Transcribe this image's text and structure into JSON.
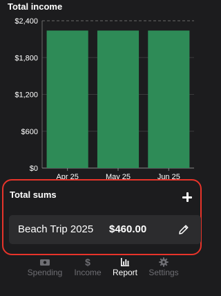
{
  "colors": {
    "background": "#1c1c1e",
    "bar": "#2e8b57",
    "highlight_border": "#e8342a",
    "row_background": "#2c2c2e",
    "tab_inactive": "#6e6e73",
    "tab_active": "#ffffff"
  },
  "chart_data": {
    "type": "bar",
    "title": "Total income",
    "categories": [
      "Apr 25",
      "May 25",
      "Jun 25"
    ],
    "values": [
      2240,
      2240,
      2240
    ],
    "ylim": [
      0,
      2400
    ],
    "yticks": [
      0,
      600,
      1200,
      1800,
      2400
    ],
    "ytick_labels": [
      "$0",
      "$600",
      "$1,200",
      "$1,800",
      "$2,400"
    ],
    "grid": true,
    "top_line_dashed": true,
    "legend": "none"
  },
  "total_sums": {
    "title": "Total sums",
    "add_icon": "plus-icon",
    "items": [
      {
        "name": "Beach Trip 2025",
        "amount": "$460.00",
        "edit_icon": "pencil-icon"
      }
    ]
  },
  "tabbar": {
    "tabs": [
      {
        "label": "Spending",
        "icon": "wallet-icon",
        "active": false
      },
      {
        "label": "Income",
        "icon": "dollar-icon",
        "active": false
      },
      {
        "label": "Report",
        "icon": "bar-chart-icon",
        "active": true
      },
      {
        "label": "Settings",
        "icon": "gear-icon",
        "active": false
      }
    ]
  }
}
